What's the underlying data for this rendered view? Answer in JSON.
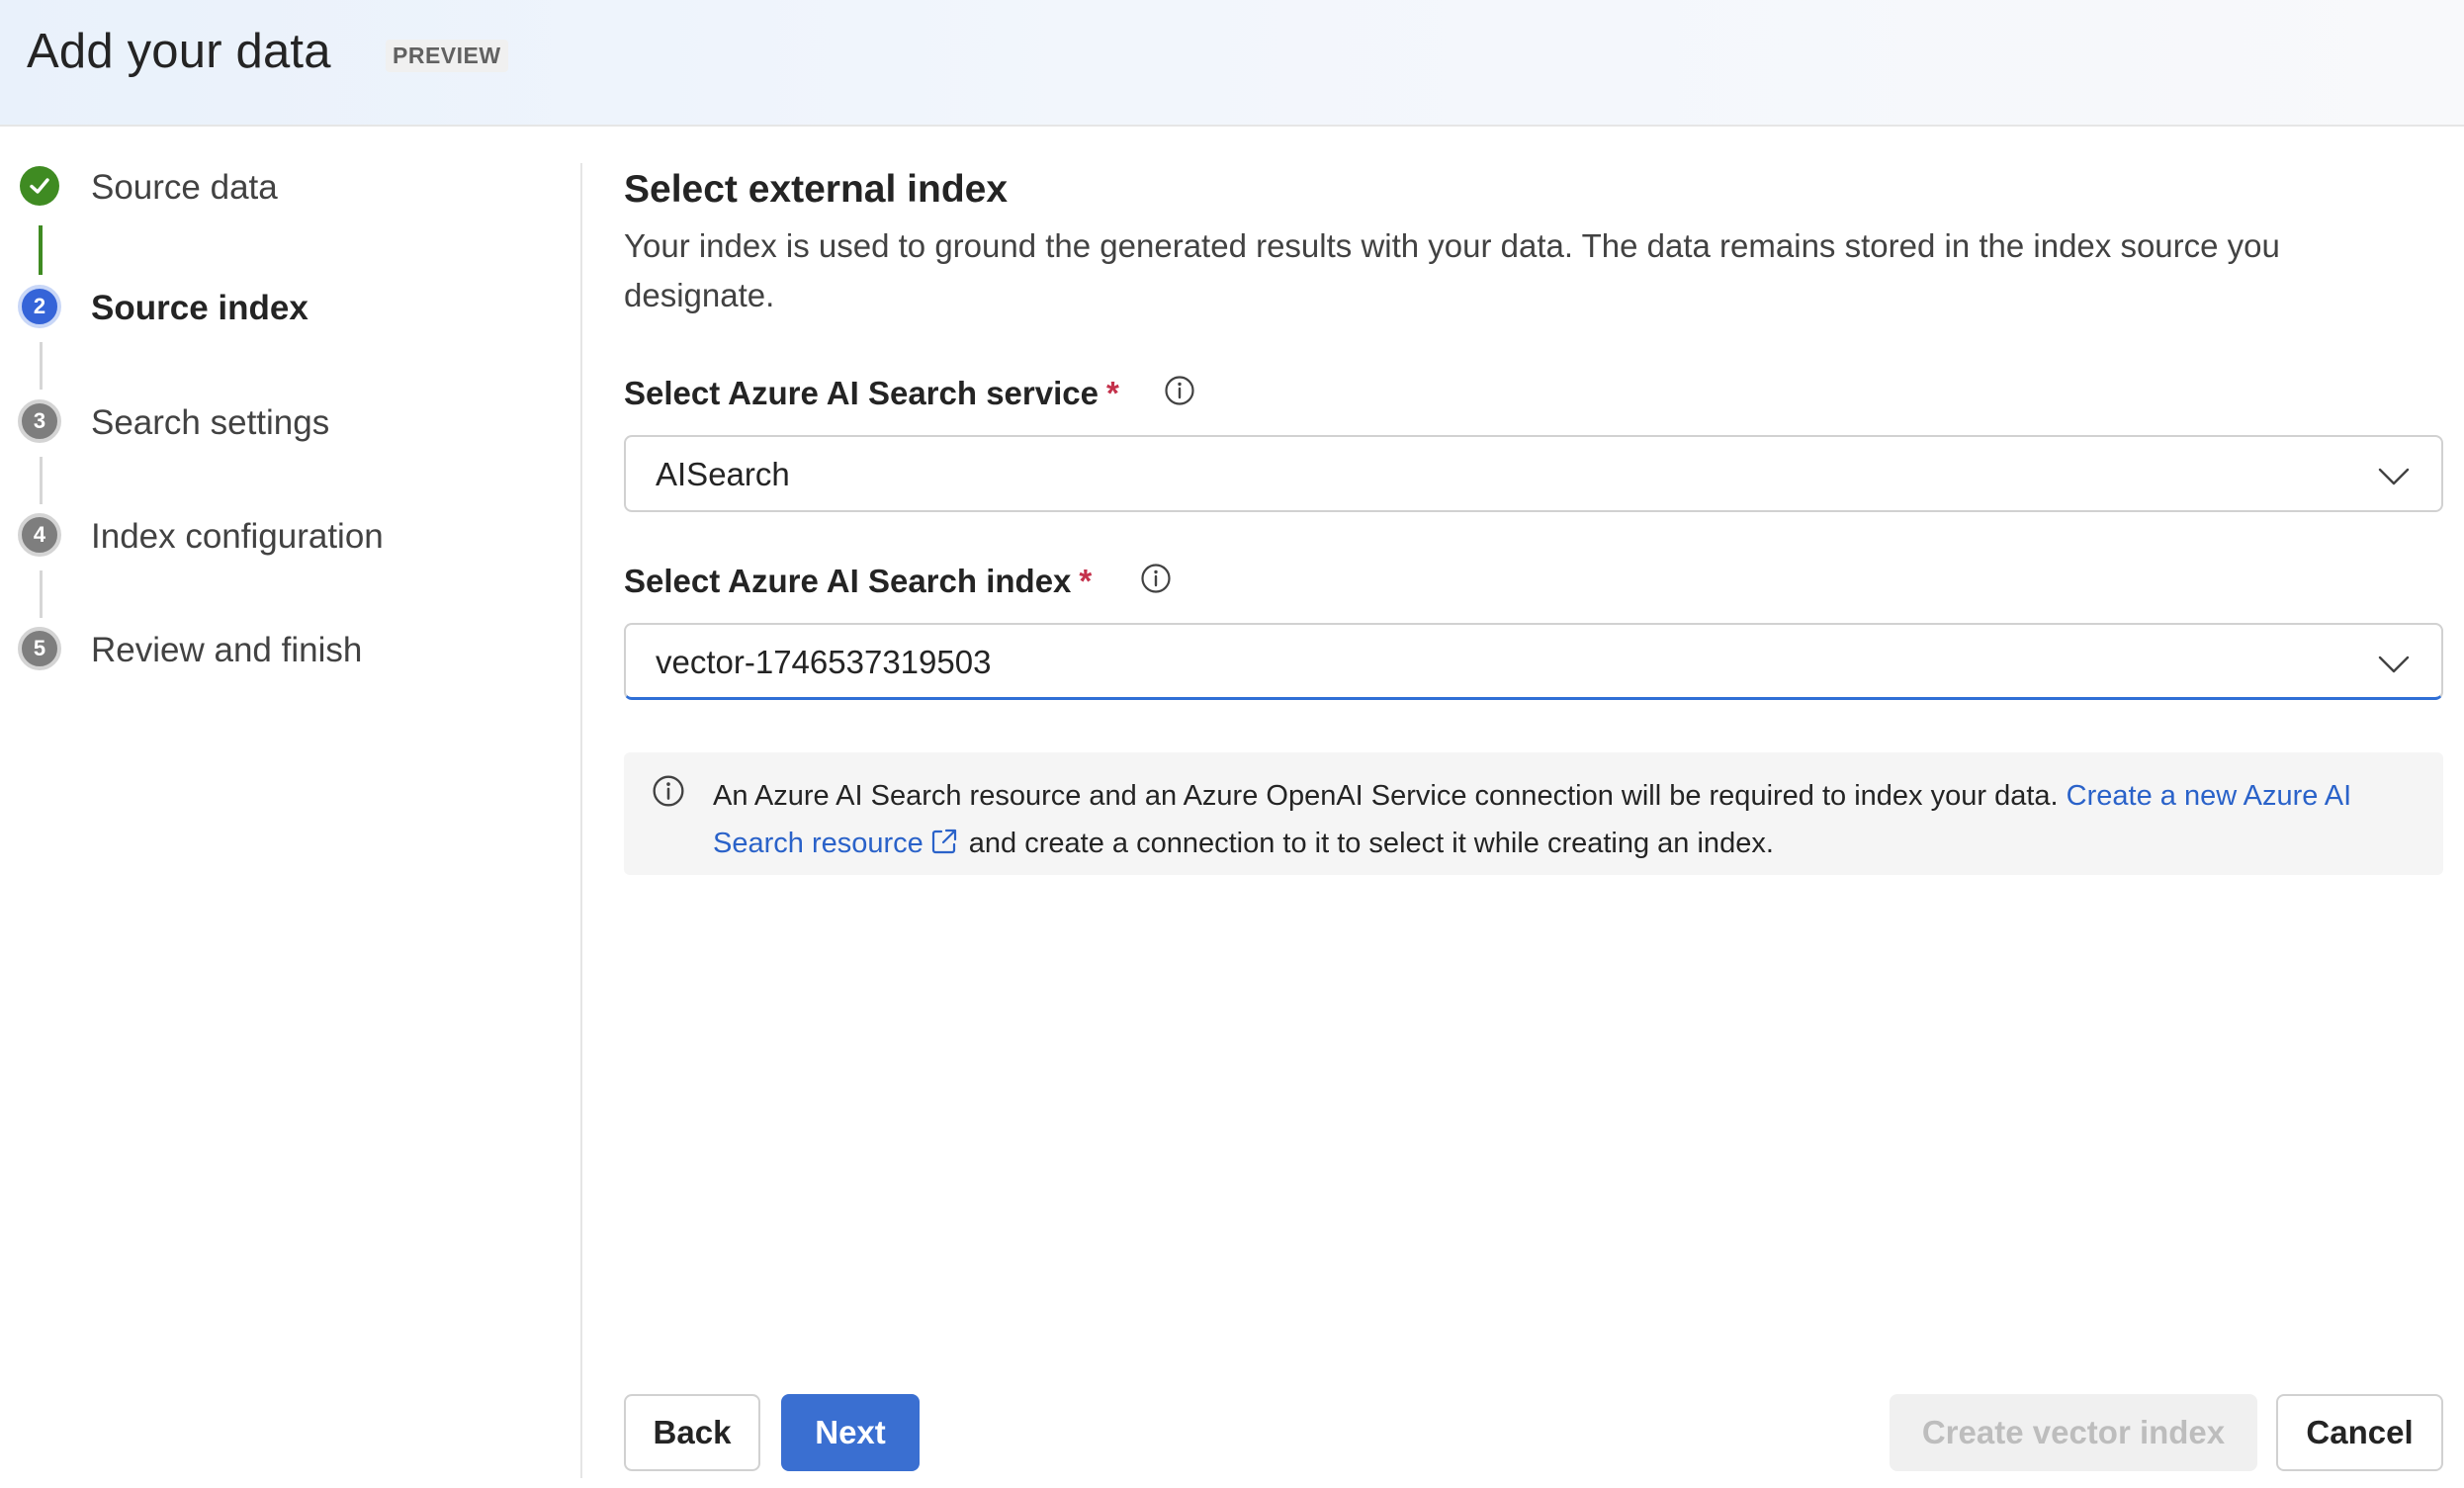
{
  "header": {
    "title": "Add your data",
    "badge": "PREVIEW"
  },
  "steps": [
    {
      "number": "1",
      "label": "Source data",
      "state": "done"
    },
    {
      "number": "2",
      "label": "Source index",
      "state": "current"
    },
    {
      "number": "3",
      "label": "Search settings",
      "state": "pending"
    },
    {
      "number": "4",
      "label": "Index configuration",
      "state": "pending"
    },
    {
      "number": "5",
      "label": "Review and finish",
      "state": "pending"
    }
  ],
  "main": {
    "title": "Select external index",
    "description": "Your index is used to ground the generated results with your data. The data remains stored in the index source you designate.",
    "service_field": {
      "label": "Select Azure AI Search service",
      "required": "*",
      "value": "AISearch"
    },
    "index_field": {
      "label": "Select Azure AI Search index",
      "required": "*",
      "value": "vector-1746537319503"
    },
    "info": {
      "text_before": "An Azure AI Search resource and an Azure OpenAI Service connection will be required to index your data.",
      "link_text": "Create a new Azure AI Search resource",
      "text_after": "and create a connection to it to select it while creating an index."
    }
  },
  "buttons": {
    "back": "Back",
    "next": "Next",
    "create": "Create vector index",
    "cancel": "Cancel"
  },
  "colors": {
    "accent": "#3a6fd1",
    "done": "#3f8b22",
    "required": "#c4314b",
    "link": "#2a62c9"
  }
}
